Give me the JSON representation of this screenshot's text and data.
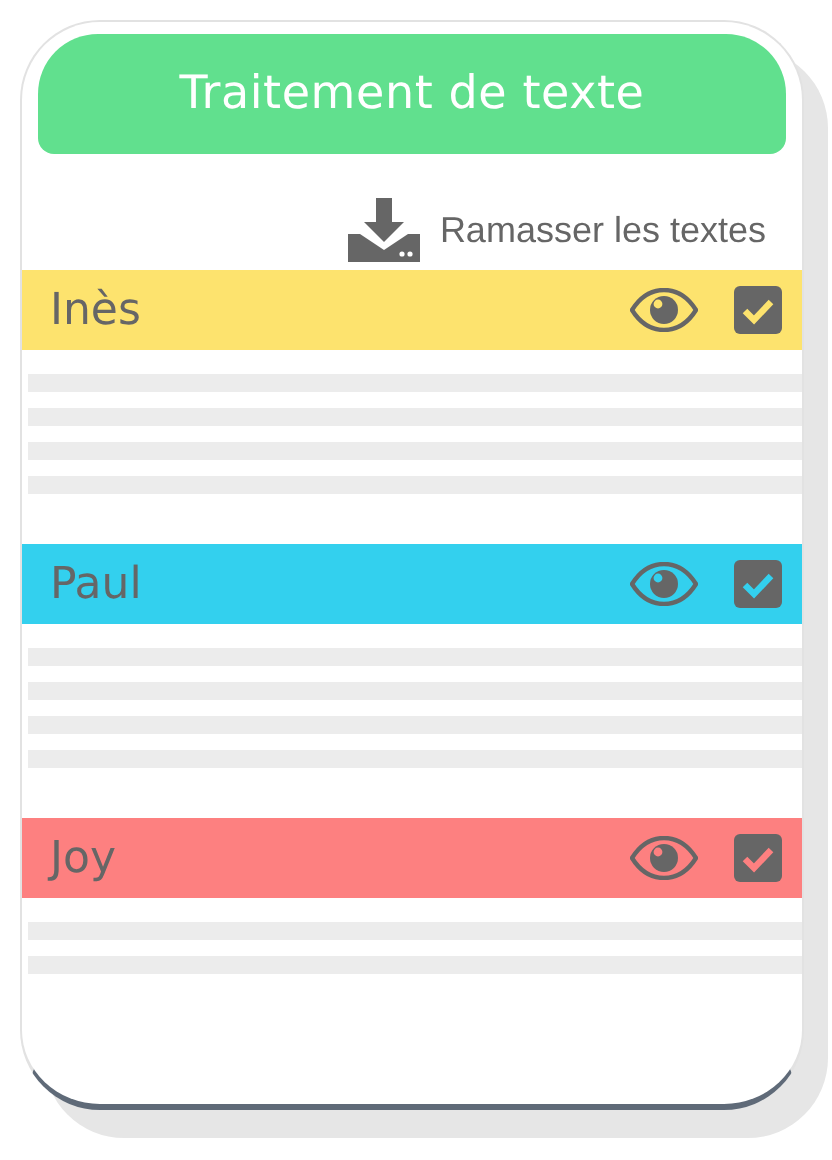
{
  "header": {
    "title": "Traitement de texte"
  },
  "collect_button": {
    "label": "Ramasser les textes"
  },
  "students": [
    {
      "name": "Inès",
      "color": "#fde36e",
      "checked": true,
      "kind": "long"
    },
    {
      "name": "Paul",
      "color": "#33d0ee",
      "checked": true,
      "kind": "long"
    },
    {
      "name": "Joy",
      "color": "#fd8080",
      "checked": true,
      "kind": "short"
    }
  ]
}
